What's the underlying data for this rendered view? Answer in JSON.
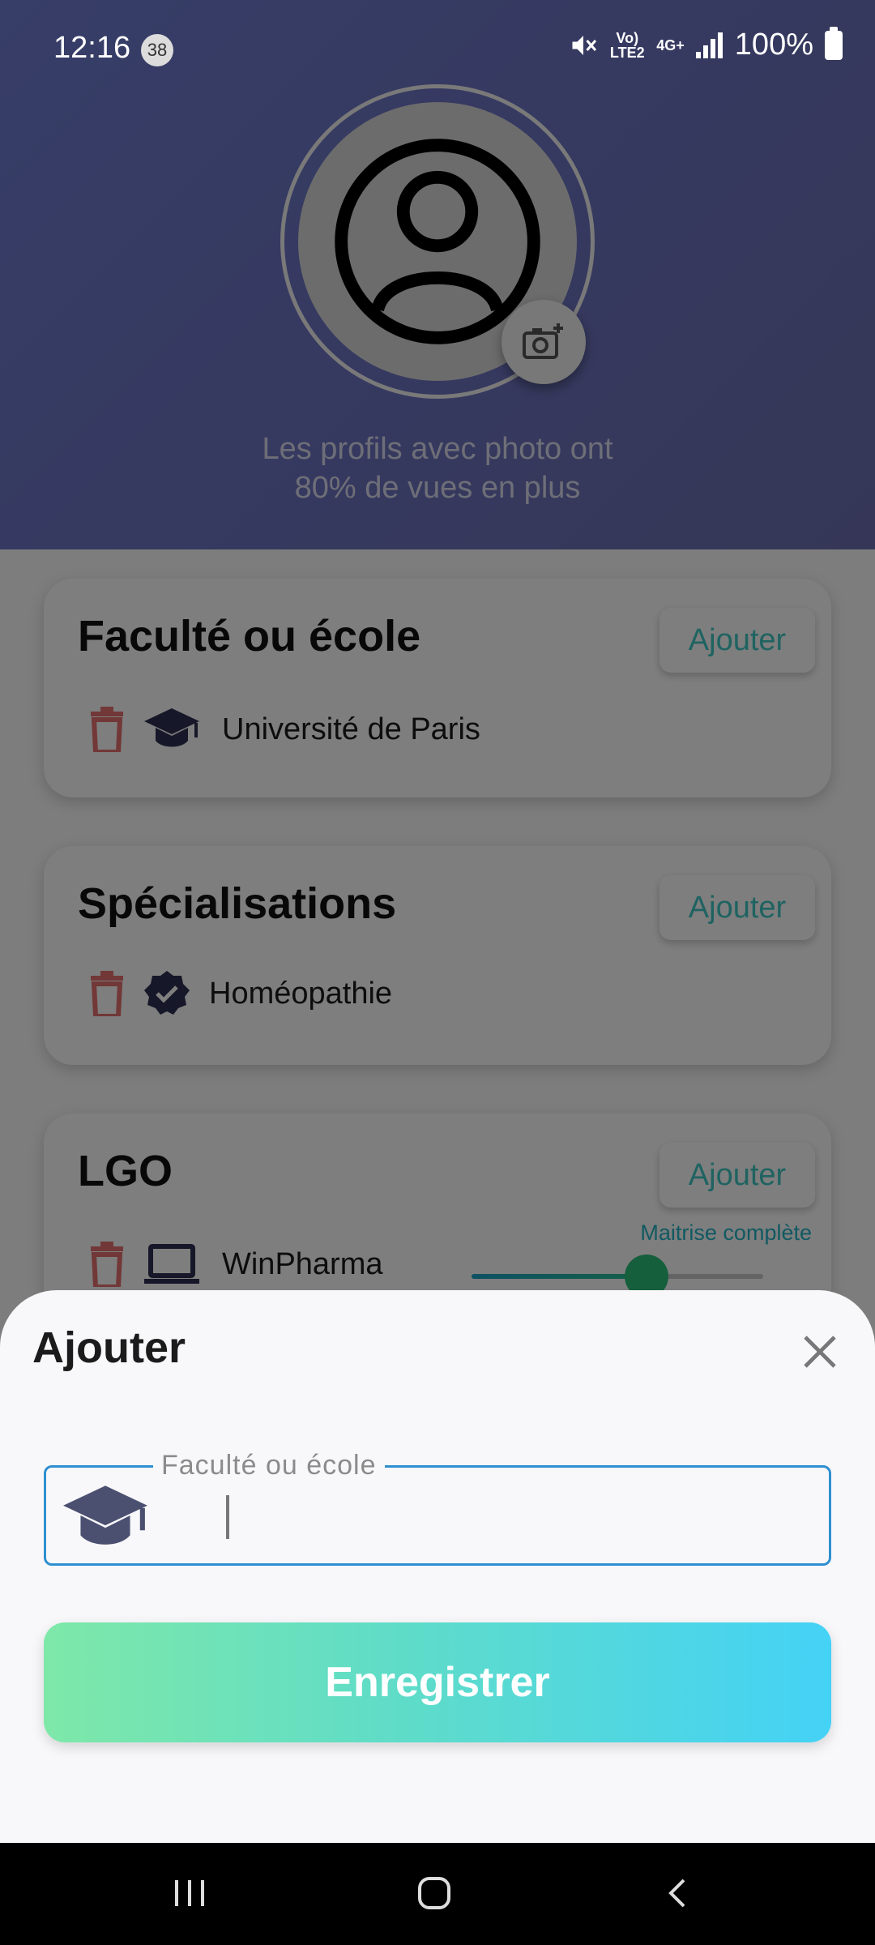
{
  "status_bar": {
    "time": "12:16",
    "notification_count": "38",
    "network_top": "Vo) LTE2",
    "network_type": "4G+",
    "battery": "100%"
  },
  "profile": {
    "photo_hint_line1": "Les profils avec photo ont",
    "photo_hint_line2": "80% de vues en plus"
  },
  "sections": [
    {
      "title": "Faculté ou école",
      "add_label": "Ajouter",
      "entry": "Université de Paris",
      "icon": "graduation-cap-icon"
    },
    {
      "title": "Spécialisations",
      "add_label": "Ajouter",
      "entry": "Homéopathie",
      "icon": "verified-badge-icon"
    },
    {
      "title": "LGO",
      "add_label": "Ajouter",
      "entry": "WinPharma",
      "icon": "laptop-icon",
      "mastery_label": "Maitrise complète",
      "mastery_level": 0.6
    }
  ],
  "sheet": {
    "title": "Ajouter",
    "field_label": "Faculté ou école",
    "field_value": "",
    "save_label": "Enregistrer"
  },
  "colors": {
    "header": "#6c74c2",
    "accent": "#3fc7c2",
    "field_border": "#2f8fd0",
    "button_start": "#7ee8a8",
    "button_end": "#44d2f6"
  }
}
